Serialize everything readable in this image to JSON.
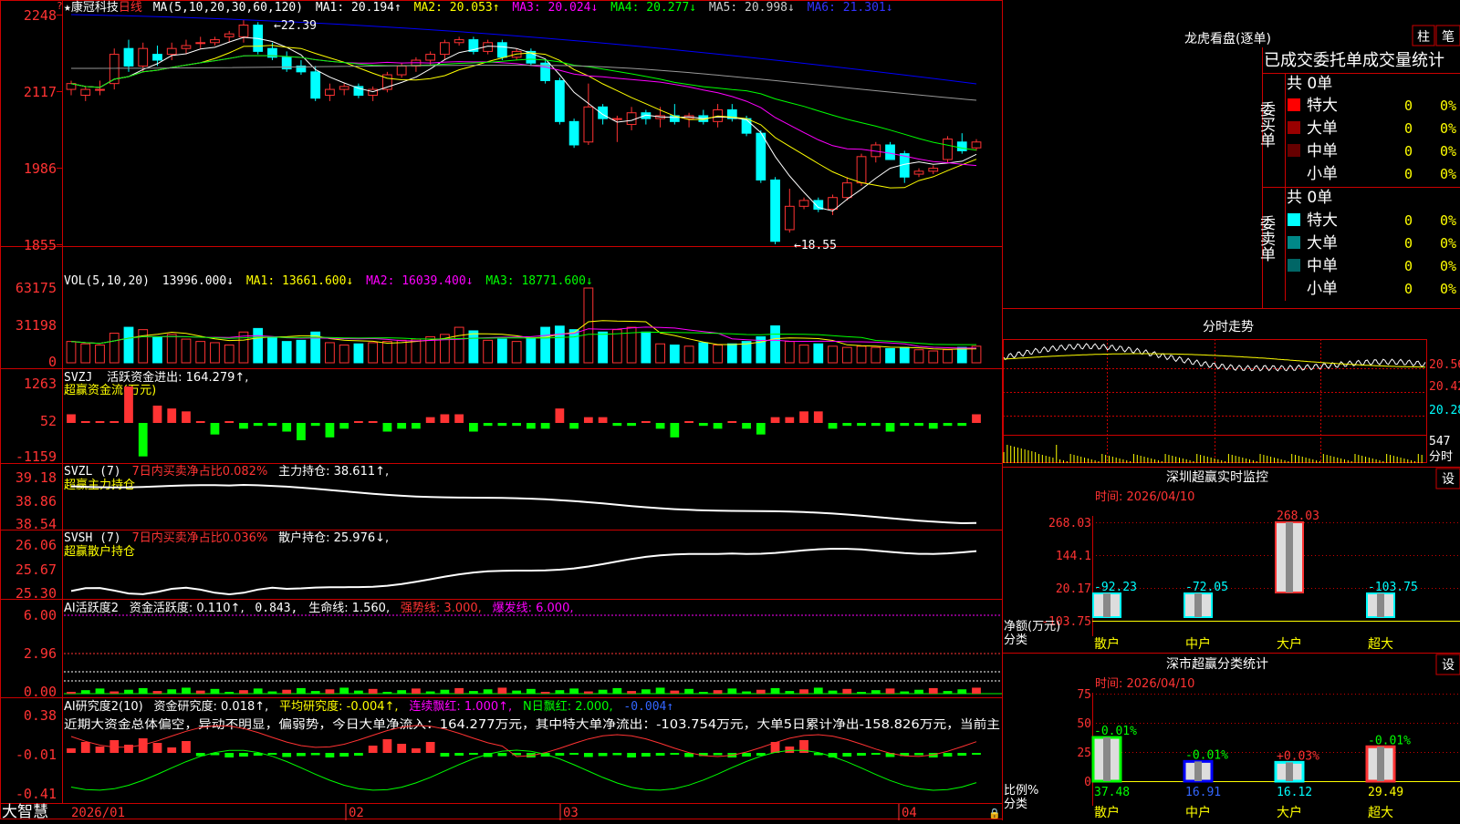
{
  "colors": {
    "up": "#ff3333",
    "down": "#00ffff",
    "grid": "#cc0000",
    "ma1": "#ffffff",
    "ma2": "#ffff00",
    "ma3": "#ff00ff",
    "ma4": "#00ff00",
    "ma5": "#999999",
    "ma6": "#0000ff",
    "axis_text": "#ff3333",
    "cyan": "#00ffff",
    "yellow": "#ffff00",
    "green": "#00ff00"
  },
  "stock": {
    "star": "★",
    "name": "康冠科技",
    "period": "日线"
  },
  "main": {
    "ma_line": {
      "head": "MA(5,10,20,30,60,120)",
      "ma1": "MA1: 20.194↑",
      "ma2": "MA2: 20.053↑",
      "ma3": "MA3: 20.024↓",
      "ma4": "MA4: 20.277↓",
      "ma5": "MA5: 20.998↓",
      "ma6": "MA6: 21.301↓"
    },
    "y_ticks": [
      "2248",
      "2117",
      "1986",
      "1855"
    ],
    "high_mark": "←22.39",
    "low_mark": "←18.55",
    "top_arrow": "?"
  },
  "volume": {
    "head": "VOL(5,10,20)",
    "value": "13996.000↓",
    "ma1": "MA1: 13661.600↓",
    "ma2": "MA2: 16039.400↓",
    "ma3": "MA3: 18771.600↓",
    "y_ticks": [
      "63175",
      "31198",
      "0"
    ]
  },
  "svzj": {
    "head": "SVZJ",
    "label": "活跃资金进出: 164.279↑,",
    "sub": "超赢资金流(万元)",
    "y_ticks": [
      "1263",
      "52",
      "-1159"
    ]
  },
  "svzl": {
    "head": "SVZL (7)",
    "buy": "7日内买卖净占比0.082%",
    "hold": "主力持仓: 38.611↑,",
    "sub": "超赢主力持仓",
    "y_ticks": [
      "39.18",
      "38.86",
      "38.54"
    ]
  },
  "svsh": {
    "head": "SVSH (7)",
    "buy": "7日内买卖净占比0.036%",
    "hold": "散户持仓: 25.976↓,",
    "sub": "超赢散户持仓",
    "y_ticks": [
      "26.06",
      "25.67",
      "25.30"
    ]
  },
  "ai_active": {
    "head": "AI活跃度2",
    "fund": "资金活跃度: 0.110↑,",
    "v2": "0.843,",
    "life": "生命线: 1.560,",
    "strong": "强势线: 3.000,",
    "burst": "爆发线: 6.000,",
    "y_ticks": [
      "6.00",
      "2.96",
      "0.00"
    ]
  },
  "ai_research": {
    "head": "AI研究度2(10)",
    "fund": "资金研究度: 0.018↑,",
    "avg": "平均研究度: -0.004↑,",
    "cont": "连续飘红: 1.000↑,",
    "nday": "N日飘红: 2.000,",
    "neg": "-0.004↑",
    "summary": "近期大资金总体偏空，异动不明显，偏弱势，今日大单净流入：164.277万元，其中特大单净流出：-103.754万元，大单5日累计净出-158.826万元，当前主",
    "y_ticks": [
      "0.38",
      "-0.01",
      "-0.41"
    ]
  },
  "x_axis": [
    "2026/01",
    "02",
    "03",
    "04"
  ],
  "brand": "大智慧",
  "lhb": {
    "title": "龙虎看盘(逐单)",
    "btn_col": "柱",
    "btn_pen": "笔",
    "header": "已成交委托单成交量统计",
    "buy_label": "委买单",
    "sell_label": "委卖单",
    "buy_total": "共 0单",
    "sell_total": "共 0单",
    "rows": [
      {
        "label": "特大",
        "count": "0",
        "pct": "0%"
      },
      {
        "label": "大单",
        "count": "0",
        "pct": "0%"
      },
      {
        "label": "中单",
        "count": "0",
        "pct": "0%"
      },
      {
        "label": "小单",
        "count": "0",
        "pct": "0%"
      }
    ],
    "sell_rows": [
      {
        "label": "特大",
        "count": "0",
        "pct": "0%"
      },
      {
        "label": "大单",
        "count": "0",
        "pct": "0%"
      },
      {
        "label": "中单",
        "count": "0",
        "pct": "0%"
      },
      {
        "label": "小单",
        "count": "0",
        "pct": "0%"
      }
    ]
  },
  "intraday": {
    "title": "分时走势",
    "prices": [
      "20.56",
      "20.42",
      "20.28"
    ],
    "vol": "547",
    "vol_unit": "分时"
  },
  "monitor": {
    "title": "深圳超赢实时监控",
    "btn": "设",
    "time": "时间: 2026/04/10",
    "y_ticks": [
      "268.03",
      "144.1",
      "20.17",
      "-103.75"
    ],
    "ylabel1": "净额(万元)",
    "ylabel2": "分类",
    "bars": [
      {
        "cat": "散户",
        "value": -92.23,
        "label": "-92.23"
      },
      {
        "cat": "中户",
        "value": -72.05,
        "label": "-72.05"
      },
      {
        "cat": "大户",
        "value": 268.03,
        "label": "268.03"
      },
      {
        "cat": "超大",
        "value": -103.75,
        "label": "-103.75"
      }
    ]
  },
  "classify": {
    "title": "深市超赢分类统计",
    "btn": "设",
    "time": "时间: 2026/04/10",
    "y_ticks": [
      "75",
      "50",
      "25",
      "0"
    ],
    "ylabel1": "比例%",
    "ylabel2": "分类",
    "bars": [
      {
        "cat": "散户",
        "value": 37.48,
        "label": "37.48",
        "chg": "-0.01%",
        "color": "#00ff00"
      },
      {
        "cat": "中户",
        "value": 16.91,
        "label": "16.91",
        "chg": "-0.01%",
        "color": "#0000ff"
      },
      {
        "cat": "大户",
        "value": 16.12,
        "label": "16.12",
        "chg": "+0.03%",
        "color": "#00ffff"
      },
      {
        "cat": "超大",
        "value": 29.49,
        "label": "29.49",
        "chg": "-0.01%",
        "color": "#ff3333"
      }
    ]
  },
  "chart_data": {
    "type": "candlestick",
    "y_ticks": [
      22.48,
      21.17,
      19.86,
      18.55
    ],
    "high": 22.39,
    "low": 18.55,
    "ohlc": [
      [
        21.2,
        21.35,
        21.1,
        21.3
      ],
      [
        21.1,
        21.25,
        21.0,
        21.2
      ],
      [
        21.2,
        21.35,
        21.1,
        21.2
      ],
      [
        21.3,
        21.9,
        21.2,
        21.8
      ],
      [
        21.9,
        22.05,
        21.5,
        21.6
      ],
      [
        21.6,
        22.0,
        21.5,
        21.9
      ],
      [
        21.8,
        21.95,
        21.6,
        21.7
      ],
      [
        21.8,
        22.0,
        21.7,
        21.9
      ],
      [
        21.9,
        22.05,
        21.8,
        21.95
      ],
      [
        22.0,
        22.1,
        21.9,
        22.0
      ],
      [
        22.0,
        22.1,
        21.95,
        22.05
      ],
      [
        22.1,
        22.2,
        22.0,
        22.15
      ],
      [
        22.1,
        22.39,
        22.0,
        22.3
      ],
      [
        22.3,
        22.35,
        21.8,
        21.85
      ],
      [
        21.9,
        22.0,
        21.7,
        21.75
      ],
      [
        21.75,
        21.85,
        21.5,
        21.55
      ],
      [
        21.6,
        21.7,
        21.45,
        21.5
      ],
      [
        21.5,
        21.6,
        21.0,
        21.05
      ],
      [
        21.1,
        21.3,
        21.0,
        21.2
      ],
      [
        21.2,
        21.3,
        21.1,
        21.25
      ],
      [
        21.25,
        21.3,
        21.05,
        21.1
      ],
      [
        21.1,
        21.25,
        21.0,
        21.2
      ],
      [
        21.2,
        21.5,
        21.15,
        21.45
      ],
      [
        21.45,
        21.65,
        21.4,
        21.6
      ],
      [
        21.6,
        21.75,
        21.5,
        21.7
      ],
      [
        21.7,
        21.85,
        21.6,
        21.8
      ],
      [
        21.8,
        22.05,
        21.7,
        22.0
      ],
      [
        22.0,
        22.1,
        21.95,
        22.05
      ],
      [
        22.05,
        22.1,
        21.8,
        21.85
      ],
      [
        21.85,
        22.05,
        21.8,
        22.0
      ],
      [
        22.0,
        22.05,
        21.7,
        21.75
      ],
      [
        21.75,
        21.9,
        21.7,
        21.85
      ],
      [
        21.85,
        21.9,
        21.6,
        21.65
      ],
      [
        21.65,
        21.7,
        21.3,
        21.35
      ],
      [
        21.35,
        21.4,
        20.6,
        20.65
      ],
      [
        20.65,
        20.7,
        20.2,
        20.25
      ],
      [
        20.3,
        21.3,
        20.25,
        20.9
      ],
      [
        20.9,
        20.95,
        20.6,
        20.7
      ],
      [
        20.7,
        20.75,
        20.3,
        20.7
      ],
      [
        20.6,
        20.9,
        20.5,
        20.8
      ],
      [
        20.8,
        20.85,
        20.6,
        20.7
      ],
      [
        20.7,
        20.9,
        20.55,
        20.75
      ],
      [
        20.75,
        20.95,
        20.6,
        20.65
      ],
      [
        20.7,
        20.8,
        20.55,
        20.75
      ],
      [
        20.75,
        20.85,
        20.6,
        20.65
      ],
      [
        20.65,
        20.95,
        20.55,
        20.85
      ],
      [
        20.85,
        20.95,
        20.65,
        20.7
      ],
      [
        20.7,
        20.75,
        20.4,
        20.45
      ],
      [
        20.45,
        20.5,
        19.6,
        19.65
      ],
      [
        19.65,
        19.7,
        18.55,
        18.6
      ],
      [
        18.8,
        19.5,
        18.75,
        19.2
      ],
      [
        19.2,
        19.35,
        19.15,
        19.3
      ],
      [
        19.3,
        19.35,
        19.1,
        19.15
      ],
      [
        19.15,
        19.4,
        19.05,
        19.35
      ],
      [
        19.35,
        19.7,
        19.3,
        19.6
      ],
      [
        19.6,
        20.1,
        19.55,
        20.05
      ],
      [
        20.05,
        20.3,
        19.95,
        20.25
      ],
      [
        20.25,
        20.3,
        20.0,
        20.0
      ],
      [
        20.1,
        20.15,
        19.6,
        19.7
      ],
      [
        19.75,
        19.85,
        19.7,
        19.8
      ],
      [
        19.8,
        19.9,
        19.75,
        19.85
      ],
      [
        20.0,
        20.4,
        19.95,
        20.35
      ],
      [
        20.3,
        20.45,
        20.1,
        20.15
      ],
      [
        20.2,
        20.35,
        20.15,
        20.3
      ]
    ],
    "volume": [
      18000,
      16000,
      15000,
      25000,
      30000,
      28000,
      22000,
      24000,
      20000,
      18000,
      17000,
      15000,
      26000,
      29000,
      22000,
      18000,
      19000,
      26000,
      17000,
      15000,
      16000,
      17000,
      18000,
      19000,
      20000,
      22000,
      24000,
      30000,
      27000,
      19000,
      20000,
      18000,
      21000,
      30000,
      31000,
      28000,
      63175,
      26000,
      28000,
      30000,
      26000,
      16000,
      15000,
      14000,
      17000,
      15000,
      16000,
      18000,
      22000,
      31198,
      18000,
      15000,
      16000,
      14000,
      13000,
      14000,
      13000,
      12000,
      13000,
      11000,
      10000,
      11000,
      13000,
      13996
    ]
  }
}
